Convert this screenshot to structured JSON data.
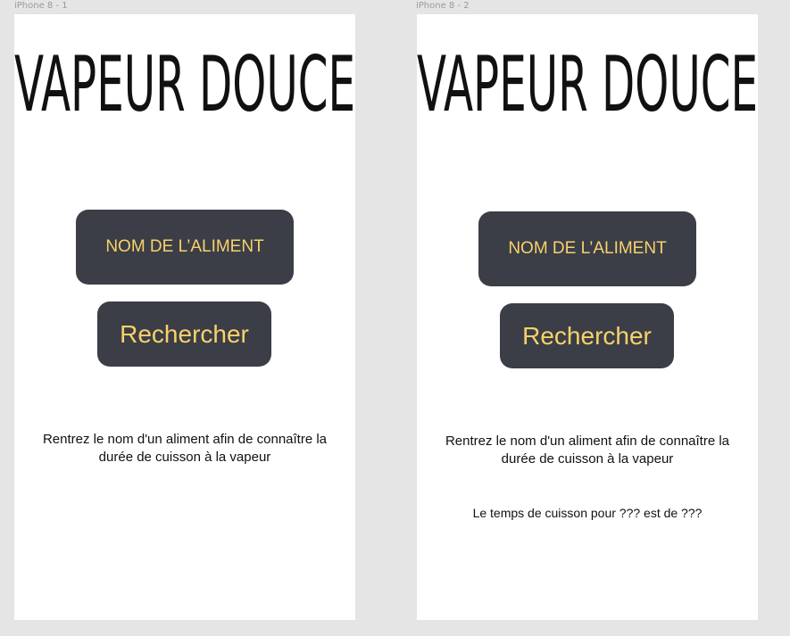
{
  "artboards": [
    {
      "label": "iPhone 8 - 1",
      "logo_text": "VAPEUR DOUCE",
      "food_input_placeholder": "NOM DE L’ALIMENT",
      "search_button_label": "Rechercher",
      "instructions": "Rentrez le nom d'un aliment afin de connaître la durée de cuisson à la vapeur"
    },
    {
      "label": "iPhone 8 - 2",
      "logo_text": "VAPEUR DOUCE",
      "food_input_placeholder": "NOM DE L’ALIMENT",
      "search_button_label": "Rechercher",
      "instructions": "Rentrez le nom d'un aliment afin de connaître la durée de cuisson à la vapeur",
      "result_text": "Le temps de cuisson pour ??? est de ???"
    }
  ],
  "colors": {
    "canvas_background": "#e5e5e5",
    "artboard_background": "#ffffff",
    "button_background": "#3b3e47",
    "button_text": "#f9d16a",
    "body_text": "#111111"
  }
}
